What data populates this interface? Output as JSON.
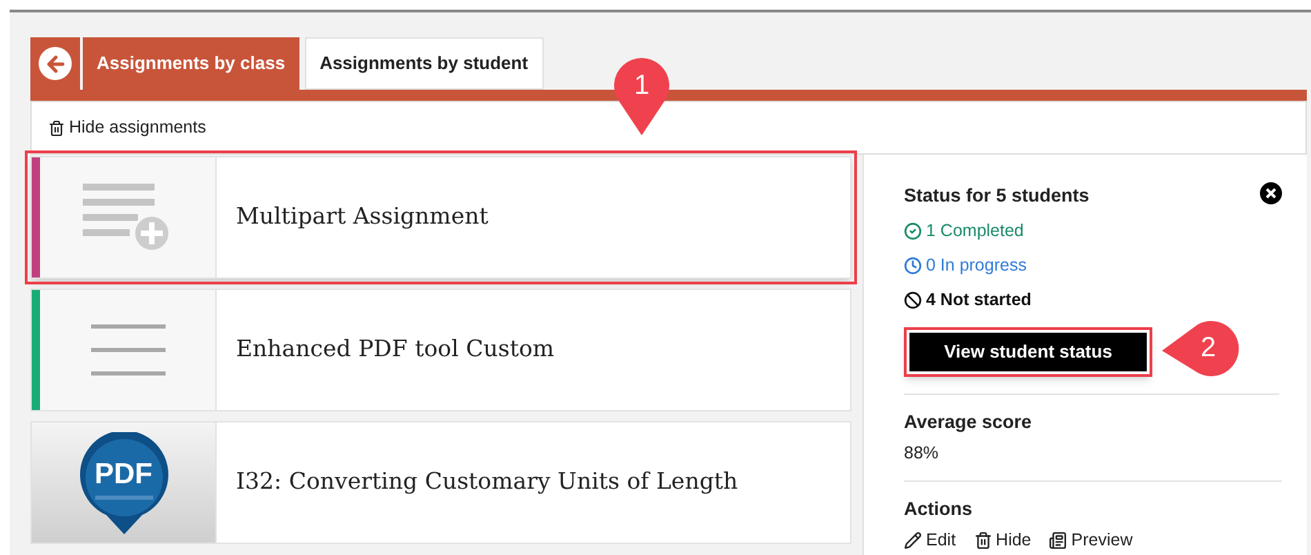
{
  "tabs": [
    {
      "label": "Assignments by class",
      "selected": true
    },
    {
      "label": "Assignments by student",
      "selected": false
    }
  ],
  "toolbar": {
    "hide_label": "Hide assignments"
  },
  "assignments": [
    {
      "title": "Multipart Assignment",
      "kind": "multipart",
      "color": "#c0407f",
      "highlighted": true
    },
    {
      "title": "Enhanced PDF tool Custom",
      "kind": "lines",
      "color": "#1aab76",
      "highlighted": false
    },
    {
      "title": "I32: Converting Customary Units of Length",
      "kind": "pdf",
      "icon_text": "PDF",
      "highlighted": false
    }
  ],
  "status_panel": {
    "title": "Status for 5 students",
    "statuses": [
      {
        "kind": "completed",
        "label": "1 Completed",
        "color": "#1a8a6a"
      },
      {
        "kind": "in_progress",
        "label": "0 In progress",
        "color": "#2f7bd8"
      },
      {
        "kind": "not_started",
        "label": "4 Not started",
        "color": "#111111"
      }
    ],
    "button": {
      "label": "View student status",
      "highlighted": true
    },
    "average": {
      "heading": "Average score",
      "value": "88%"
    },
    "actions": {
      "heading": "Actions",
      "items": [
        {
          "kind": "edit",
          "label": "Edit"
        },
        {
          "kind": "hide",
          "label": "Hide"
        },
        {
          "kind": "preview",
          "label": "Preview"
        }
      ]
    }
  },
  "callouts": [
    {
      "label": "1",
      "kind": "pin"
    },
    {
      "label": "2",
      "kind": "tag"
    }
  ]
}
